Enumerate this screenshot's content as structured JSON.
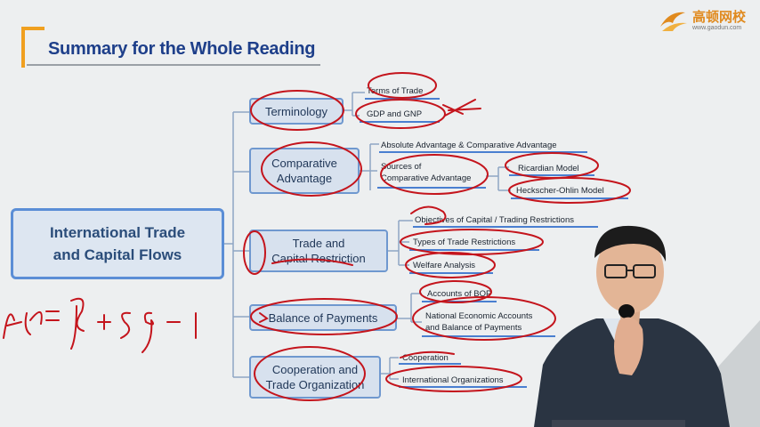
{
  "title": "Summary for the Whole Reading",
  "logo": {
    "name": "高顿网校",
    "url": "www.gaodun.com"
  },
  "root": {
    "label": "International Trade\nand Capital Flows"
  },
  "branches": [
    {
      "label": "Terminology",
      "children": [
        "Terms of Trade",
        "GDP and GNP"
      ]
    },
    {
      "label": "Comparative\nAdvantage",
      "children": [
        "Absolute Advantage & Comparative Advantage",
        "Sources of\nComparative Advantage",
        "Ricardian Model",
        "Heckscher-Ohlin Model"
      ]
    },
    {
      "label": "Trade and\nCapital Restriction",
      "children": [
        "Objectives of Capital / Trading Restrictions",
        "Types of Trade Restrictions",
        "Welfare Analysis"
      ]
    },
    {
      "label": "Balance of Payments",
      "children": [
        "Accounts of BOP",
        "National Economic Accounts\nand Balance of Payments"
      ]
    },
    {
      "label": "Cooperation and\nTrade Organization",
      "children": [
        "Cooperation",
        "International Organizations"
      ]
    }
  ],
  "handwriting": {
    "formula": "X−M = Sp + Sg − I"
  },
  "colors": {
    "title": "#1e3f8a",
    "accent": "#f0a020",
    "node_fill": "#d7e1ee",
    "node_border": "#6f98cf",
    "ink": "#c4141c",
    "logo": "#e08a1e"
  }
}
